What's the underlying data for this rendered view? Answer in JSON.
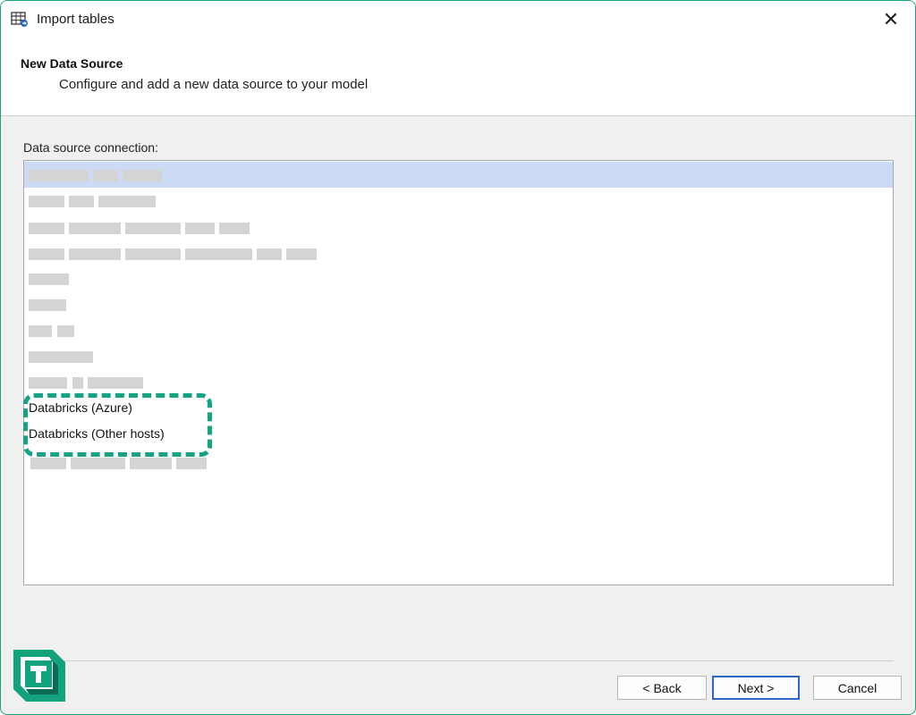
{
  "window": {
    "title": "Import tables",
    "close_glyph": "✕"
  },
  "header": {
    "title": "New Data Source",
    "subtitle": "Configure and add a new data source to your model"
  },
  "list": {
    "label": "Data source connection:",
    "items": [
      {
        "text": "",
        "redacted": true,
        "selected": true
      },
      {
        "text": "",
        "redacted": true
      },
      {
        "text": "",
        "redacted": true
      },
      {
        "text": "",
        "redacted": true
      },
      {
        "text": "",
        "redacted": true
      },
      {
        "text": "",
        "redacted": true
      },
      {
        "text": "",
        "redacted": true
      },
      {
        "text": "",
        "redacted": true
      },
      {
        "text": "",
        "redacted": true
      },
      {
        "text": "Databricks (Azure)"
      },
      {
        "text": "Databricks (Other hosts)"
      },
      {
        "text": "",
        "redacted": true
      }
    ]
  },
  "buttons": {
    "back": "< Back",
    "next": "Next >",
    "cancel": "Cancel"
  },
  "colors": {
    "accent": "#16a383",
    "selection": "#ccdaf3",
    "default_button_border": "#2b67c6",
    "logo_green": "#12a37e",
    "logo_dark": "#0c6b55"
  },
  "icons": {
    "title": "table-import-icon",
    "logo": "tabular-editor-logo"
  }
}
